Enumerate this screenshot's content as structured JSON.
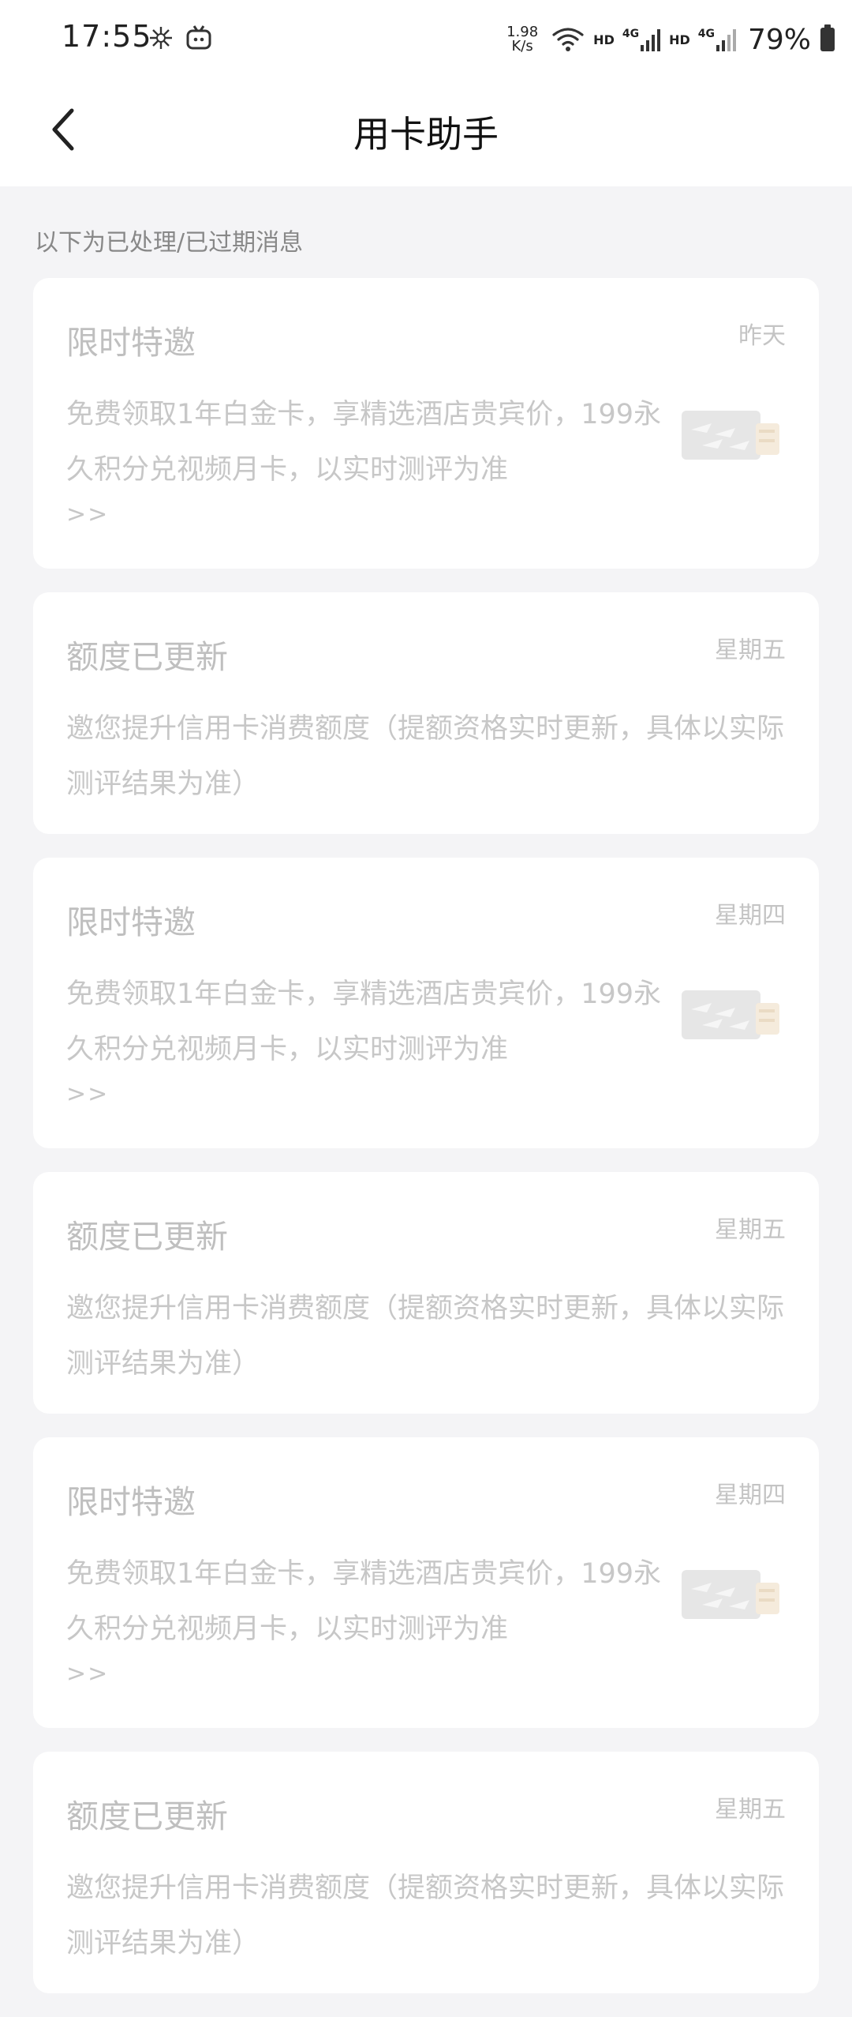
{
  "status_bar": {
    "time": "17:55",
    "speed_value": "1.98",
    "speed_unit": "K/s",
    "hd1": "HD",
    "hd2": "HD",
    "net1": "4G",
    "net2": "4G",
    "battery": "79%"
  },
  "header": {
    "title": "用卡助手"
  },
  "section_note": "以下为已处理/已过期消息",
  "messages": [
    {
      "title": "限时特邀",
      "time": "昨天",
      "body": "免费领取1年白金卡，享精选酒店贵宾价，199永久积分兑视频月卡，以实时测评为准",
      "more": ">>"
    },
    {
      "title": "额度已更新",
      "time": "星期五",
      "body": "邀您提升信用卡消费额度（提额资格实时更新，具体以实际测评结果为准）"
    },
    {
      "title": "限时特邀",
      "time": "星期四",
      "body": "免费领取1年白金卡，享精选酒店贵宾价，199永久积分兑视频月卡，以实时测评为准",
      "more": ">>"
    },
    {
      "title": "额度已更新",
      "time": "星期五",
      "body": "邀您提升信用卡消费额度（提额资格实时更新，具体以实际测评结果为准）"
    },
    {
      "title": "限时特邀",
      "time": "星期四",
      "body": "免费领取1年白金卡，享精选酒店贵宾价，199永久积分兑视频月卡，以实时测评为准",
      "more": ">>"
    },
    {
      "title": "额度已更新",
      "time": "星期五",
      "body": "邀您提升信用卡消费额度（提额资格实时更新，具体以实际测评结果为准）"
    }
  ],
  "icons": {
    "back": "back-arrow-icon",
    "card_thumbnail": "credit-card-thumbnail-icon"
  }
}
